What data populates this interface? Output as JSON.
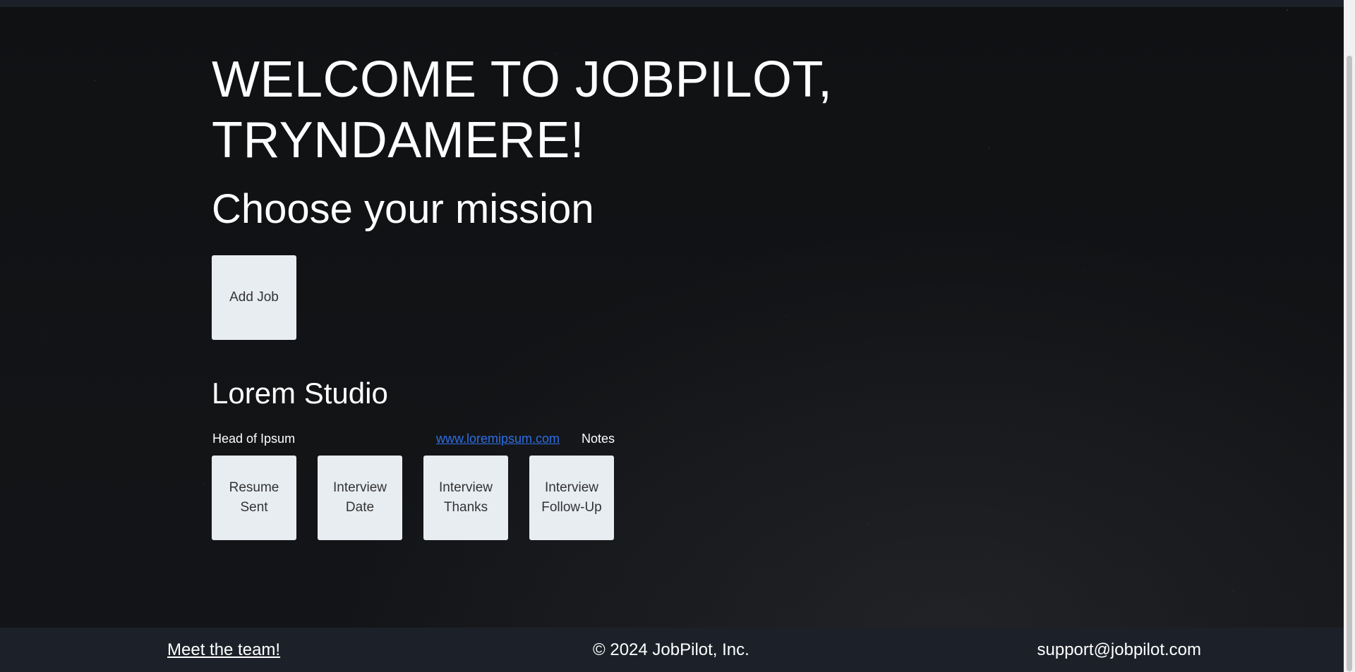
{
  "welcome": {
    "line1": "WELCOME TO JOBPILOT,",
    "line2": "TRYNDAMERE!"
  },
  "subtitle": "Choose your mission",
  "add_job_label": "Add Job",
  "job": {
    "company": "Lorem Studio",
    "title": "Head of Ipsum",
    "link": "www.loremipsum.com",
    "notes_label": "Notes",
    "stages": [
      {
        "line1": "Resume",
        "line2": "Sent"
      },
      {
        "line1": "Interview",
        "line2": "Date"
      },
      {
        "line1": "Interview",
        "line2": "Thanks"
      },
      {
        "line1": "Interview",
        "line2": "Follow-Up"
      }
    ]
  },
  "footer": {
    "team_link": "Meet the team!",
    "copyright": "© 2024 JobPilot, Inc.",
    "email": "support@jobpilot.com"
  },
  "colors": {
    "background": "#111316",
    "bar": "#1c2129",
    "tile": "#e8edf2",
    "link": "#2f6fe6"
  }
}
